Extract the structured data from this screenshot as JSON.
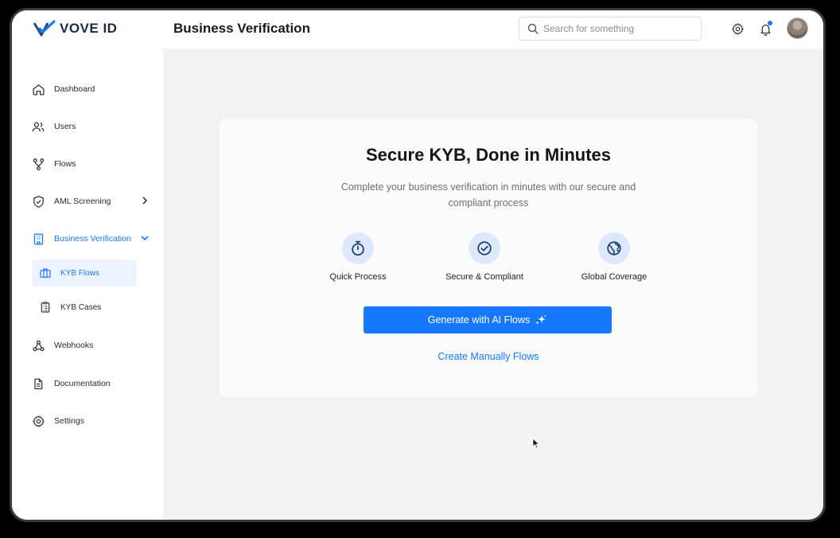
{
  "brand": {
    "name": "VOVE ID",
    "accent": "#1677ff",
    "logo_color": "#2b4a73"
  },
  "header": {
    "title": "Business Verification",
    "search_placeholder": "Search for something",
    "icons": [
      "settings-icon",
      "bell-icon",
      "avatar"
    ]
  },
  "sidebar": {
    "items": [
      {
        "label": "Dashboard",
        "icon": "home-icon"
      },
      {
        "label": "Users",
        "icon": "users-icon"
      },
      {
        "label": "Flows",
        "icon": "flows-icon"
      },
      {
        "label": "AML Screening",
        "icon": "shield-icon"
      },
      {
        "label": "Business Verification",
        "icon": "building-icon",
        "active": true,
        "expanded": true
      },
      {
        "label": "Webhooks",
        "icon": "webhook-icon"
      },
      {
        "label": "Documentation",
        "icon": "document-icon"
      },
      {
        "label": "Settings",
        "icon": "gear-icon"
      }
    ],
    "sub_items": [
      {
        "label": "KYB Flows",
        "icon": "briefcase-icon",
        "selected": true
      },
      {
        "label": "KYB Cases",
        "icon": "clipboard-icon"
      }
    ]
  },
  "main": {
    "title": "Secure KYB, Done in Minutes",
    "subtitle": "Complete your business verification in minutes with our secure and compliant process",
    "features": [
      {
        "label": "Quick Process",
        "icon": "stopwatch-icon"
      },
      {
        "label": "Secure & Compliant",
        "icon": "check-circle-icon"
      },
      {
        "label": "Global Coverage",
        "icon": "globe-icon"
      }
    ],
    "primary_button": "Generate with AI Flows",
    "secondary_link": "Create Manually Flows"
  }
}
